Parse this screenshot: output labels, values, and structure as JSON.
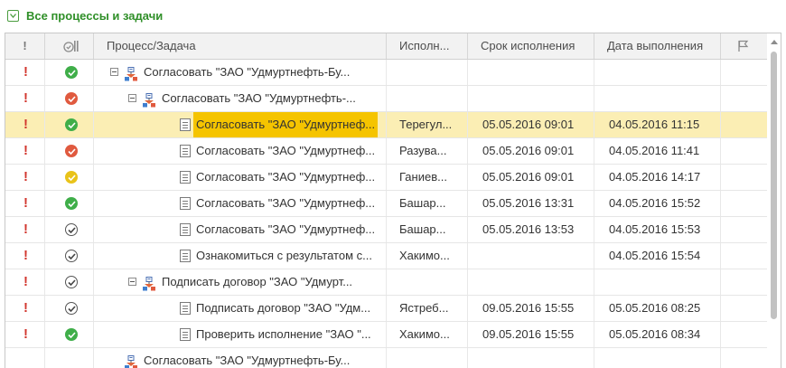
{
  "group": {
    "title": "Все процессы и задачи"
  },
  "columns": {
    "importance": "!",
    "process_task": "Процесс/Задача",
    "performer": "Исполн...",
    "due": "Срок исполнения",
    "completed": "Дата выполнения"
  },
  "rows": [
    {
      "kind": "process",
      "level": 0,
      "toggle": true,
      "status": "green",
      "title": "Согласовать \"ЗАО \"Удмуртнефть-Бу...",
      "performer": "",
      "due": "",
      "done": ""
    },
    {
      "kind": "process",
      "level": 1,
      "toggle": true,
      "status": "red",
      "title": "Согласовать \"ЗАО \"Удмуртнефть-...",
      "performer": "",
      "due": "",
      "done": ""
    },
    {
      "kind": "task",
      "level": 2,
      "status": "green",
      "selected": true,
      "title": "Согласовать \"ЗАО \"Удмуртнеф...",
      "performer": "Терегул...",
      "due": "05.05.2016 09:01",
      "done": "04.05.2016 11:15"
    },
    {
      "kind": "task",
      "level": 2,
      "status": "red",
      "title": "Согласовать \"ЗАО \"Удмуртнеф...",
      "performer": "Разува...",
      "due": "05.05.2016 09:01",
      "done": "04.05.2016 11:41"
    },
    {
      "kind": "task",
      "level": 2,
      "status": "yellow",
      "title": "Согласовать \"ЗАО \"Удмуртнеф...",
      "performer": "Ганиев...",
      "due": "05.05.2016 09:01",
      "done": "04.05.2016 14:17"
    },
    {
      "kind": "task",
      "level": 2,
      "status": "green",
      "title": "Согласовать \"ЗАО \"Удмуртнеф...",
      "performer": "Башар...",
      "due": "05.05.2016 13:31",
      "done": "04.05.2016 15:52"
    },
    {
      "kind": "task",
      "level": 2,
      "status": "gray",
      "title": "Согласовать \"ЗАО \"Удмуртнеф...",
      "performer": "Башар...",
      "due": "05.05.2016 13:53",
      "done": "04.05.2016 15:53"
    },
    {
      "kind": "task",
      "level": 2,
      "status": "gray",
      "title": "Ознакомиться с результатом с...",
      "performer": "Хакимо...",
      "due": "",
      "done": "04.05.2016 15:54"
    },
    {
      "kind": "process",
      "level": 1,
      "toggle": true,
      "status": "gray",
      "title": "Подписать договор \"ЗАО \"Удмурт...",
      "performer": "",
      "due": "",
      "done": ""
    },
    {
      "kind": "task",
      "level": 2,
      "status": "gray",
      "title": "Подписать договор \"ЗАО \"Удм...",
      "performer": "Ястреб...",
      "due": "09.05.2016 15:55",
      "done": "05.05.2016 08:25"
    },
    {
      "kind": "task",
      "level": 2,
      "status": "green",
      "title": "Проверить исполнение \"ЗАО \"...",
      "performer": "Хакимо...",
      "due": "09.05.2016 15:55",
      "done": "05.05.2016 08:34"
    },
    {
      "kind": "process",
      "level": 0,
      "toggle": false,
      "status": "none",
      "title": "Согласовать \"ЗАО \"Удмуртнефть-Бу...",
      "performer": "",
      "due": "",
      "done": ""
    }
  ],
  "colors": {
    "accent_green": "#2f8f28",
    "selection": "#fbeeb4",
    "highlight": "#f5c400",
    "importance_red": "#d2372f"
  }
}
